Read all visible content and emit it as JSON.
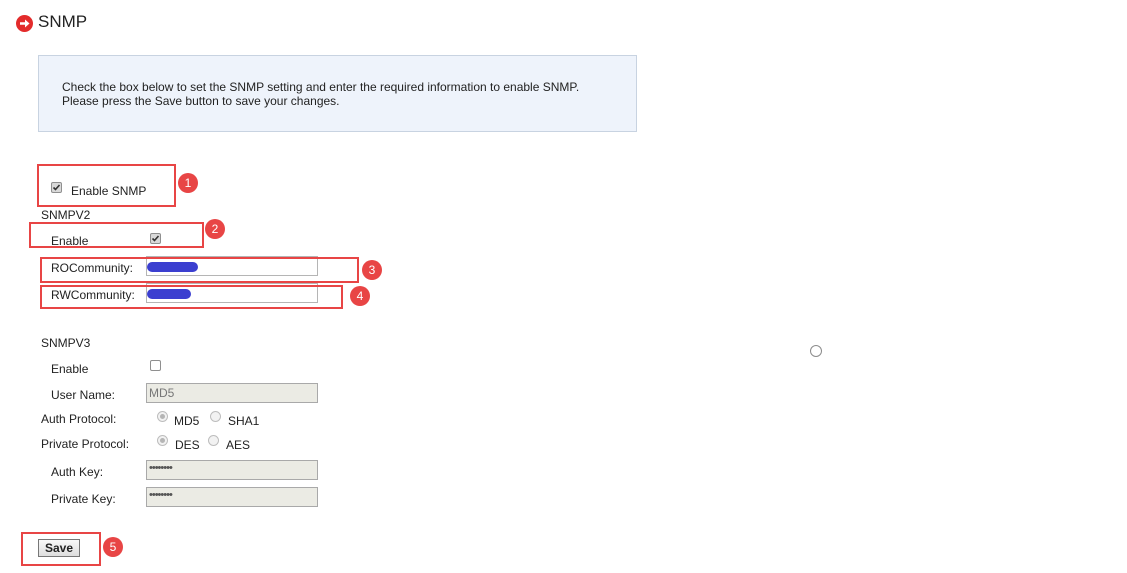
{
  "header": {
    "title": "SNMP",
    "icon": "arrow-right-circle-icon",
    "accent": "#e32b2b"
  },
  "info": {
    "line1": "Check the box below to set the SNMP setting and enter the required information to enable SNMP.",
    "line2": "Please press the Save button to save your changes."
  },
  "snmp": {
    "enable_label": "Enable SNMP",
    "enabled": true
  },
  "snmpv2": {
    "heading": "SNMPV2",
    "enable_label": "Enable",
    "enabled": true,
    "ro_label": "ROCommunity:",
    "rw_label": "RWCommunity:"
  },
  "snmpv3": {
    "heading": "SNMPV3",
    "enable_label": "Enable",
    "enabled": false,
    "username_label": "User Name:",
    "username_value": "MD5",
    "auth_protocol_label": "Auth Protocol:",
    "auth_options": [
      "MD5",
      "SHA1"
    ],
    "private_protocol_label": "Private Protocol:",
    "private_options": [
      "DES",
      "AES"
    ],
    "auth_key_label": "Auth Key:",
    "auth_key_value": "••••••••",
    "private_key_label": "Private Key:",
    "private_key_value": "••••••••"
  },
  "save_label": "Save",
  "annotations": [
    "1",
    "2",
    "3",
    "4",
    "5"
  ],
  "annotation_color": "#e84545"
}
